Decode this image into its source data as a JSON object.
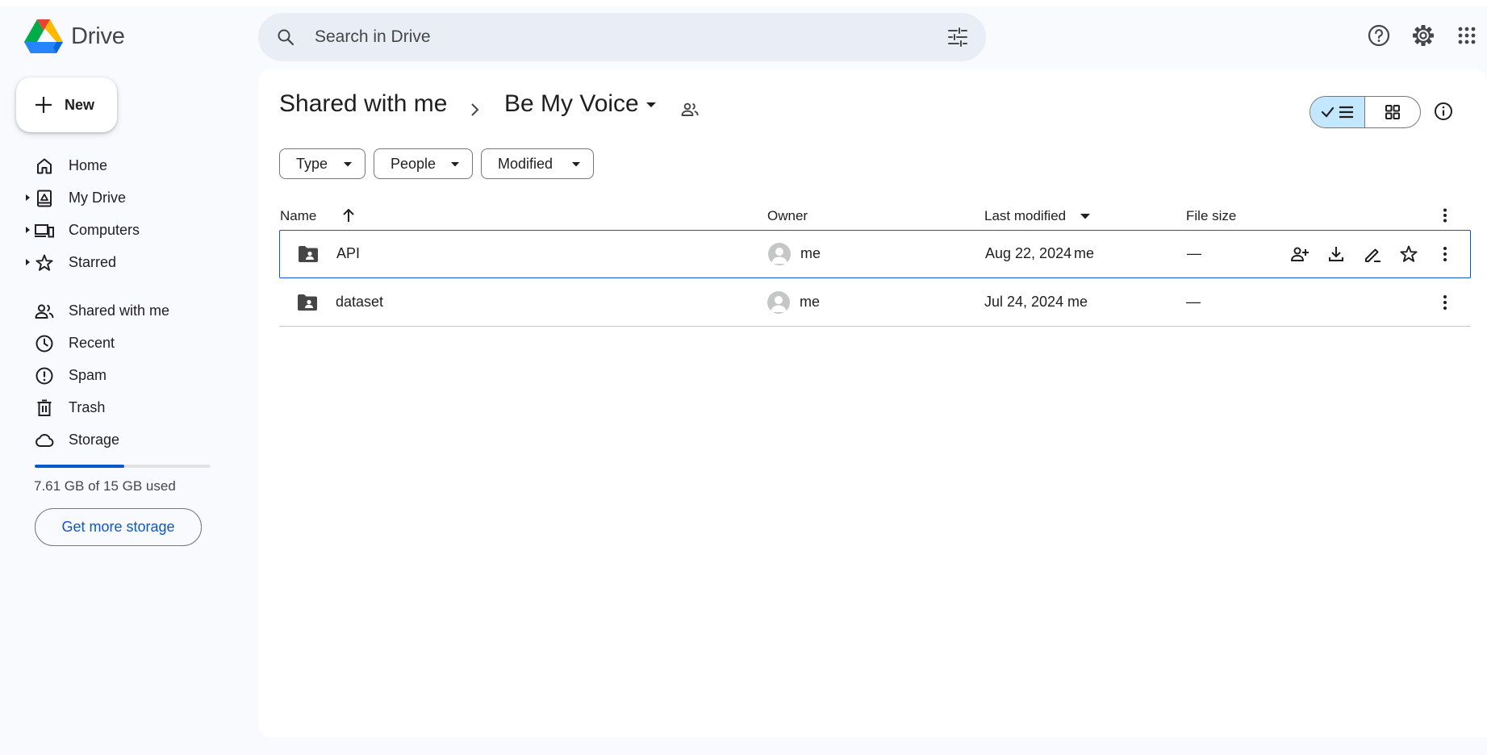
{
  "app": {
    "name": "Drive"
  },
  "search": {
    "placeholder": "Search in Drive"
  },
  "sidebar": {
    "new_label": "New",
    "items": [
      {
        "label": "Home",
        "icon": "home-icon"
      },
      {
        "label": "My Drive",
        "icon": "my-drive-icon"
      },
      {
        "label": "Computers",
        "icon": "computers-icon"
      },
      {
        "label": "Starred",
        "icon": "star-icon"
      },
      {
        "label": "Shared with me",
        "icon": "people-icon"
      },
      {
        "label": "Recent",
        "icon": "clock-icon"
      },
      {
        "label": "Spam",
        "icon": "spam-icon"
      },
      {
        "label": "Trash",
        "icon": "trash-icon"
      },
      {
        "label": "Storage",
        "icon": "cloud-icon"
      }
    ],
    "storage_used_fraction": 0.507,
    "storage_text": "7.61 GB of 15 GB used",
    "get_storage_label": "Get more storage"
  },
  "breadcrumb": {
    "parent": "Shared with me",
    "current": "Be My Voice"
  },
  "filters": [
    "Type",
    "People",
    "Modified"
  ],
  "table": {
    "columns": {
      "name": "Name",
      "owner": "Owner",
      "modified": "Last modified",
      "size": "File size"
    },
    "rows": [
      {
        "name": "API",
        "owner": "me",
        "modified": "Aug 22, 2024",
        "modified_by": "me",
        "size": "—"
      },
      {
        "name": "dataset",
        "owner": "me",
        "modified": "Jul 24, 2024",
        "modified_by": "me",
        "size": "—"
      }
    ]
  },
  "colors": {
    "accent": "#0b57d0",
    "selected_view": "#c2e7ff",
    "search_bg": "#e9eef6",
    "app_bg": "#f8fafd"
  }
}
